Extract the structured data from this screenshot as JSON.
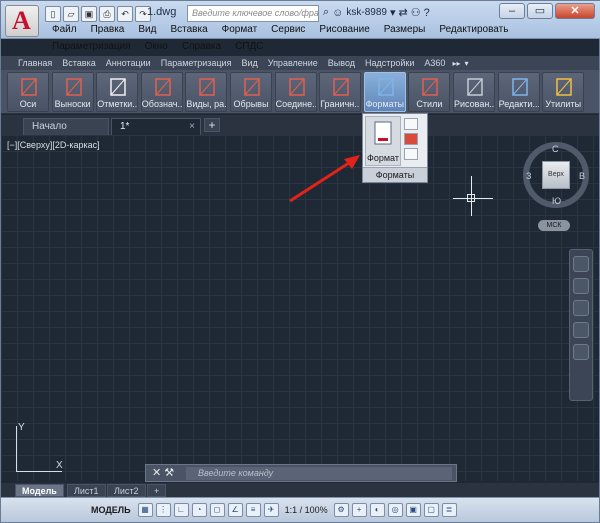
{
  "title": {
    "app_logo": "A",
    "doc_name": "1.dwg",
    "search_placeholder": "Введите ключевое слово/фразу",
    "user": "ksk-8989",
    "help": "?"
  },
  "menu_row1": [
    "Файл",
    "Правка",
    "Вид",
    "Вставка",
    "Формат",
    "Сервис",
    "Рисование",
    "Размеры",
    "Редактировать"
  ],
  "menu_row2": [
    "Параметризация",
    "Окно",
    "Справка",
    "СПДС"
  ],
  "ribbon_tabs": [
    "Главная",
    "Вставка",
    "Аннотации",
    "Параметризация",
    "Вид",
    "Управление",
    "Вывод",
    "Надстройки",
    "A360"
  ],
  "ribbon_buttons": [
    {
      "label": "Оси",
      "icon": "axis-icon"
    },
    {
      "label": "Выноски",
      "icon": "leader-icon"
    },
    {
      "label": "Отметки...",
      "icon": "elevation-mark-icon"
    },
    {
      "label": "Обознач...",
      "icon": "symbol-icon"
    },
    {
      "label": "Виды, ра...",
      "icon": "section-view-icon"
    },
    {
      "label": "Обрывы",
      "icon": "break-line-icon"
    },
    {
      "label": "Соедине...",
      "icon": "connection-icon"
    },
    {
      "label": "Граничн...",
      "icon": "boundary-icon"
    },
    {
      "label": "Форматы",
      "icon": "format-icon"
    },
    {
      "label": "Стили",
      "icon": "styles-icon"
    },
    {
      "label": "Рисован...",
      "icon": "drawing-icon"
    },
    {
      "label": "Редакти...",
      "icon": "edit-move-icon"
    },
    {
      "label": "Утилиты",
      "icon": "utilities-icon"
    }
  ],
  "file_tabs": [
    {
      "label": "Начало"
    },
    {
      "label": "1*"
    }
  ],
  "view_label": "[−][Сверху][2D-каркас]",
  "dropdown": {
    "big_button": "Формат",
    "caption": "Форматы"
  },
  "viewcube": {
    "north": "С",
    "south": "Ю",
    "east": "В",
    "west": "З",
    "face": "Верх",
    "ucs": "МСК"
  },
  "ucs_icon": {
    "x": "X",
    "y": "Y"
  },
  "command_line": {
    "placeholder": "Введите команду"
  },
  "layout_tabs": [
    "Модель",
    "Лист1",
    "Лист2"
  ],
  "status": {
    "model": "МОДЕЛЬ",
    "scale": "1:1 / 100%"
  }
}
